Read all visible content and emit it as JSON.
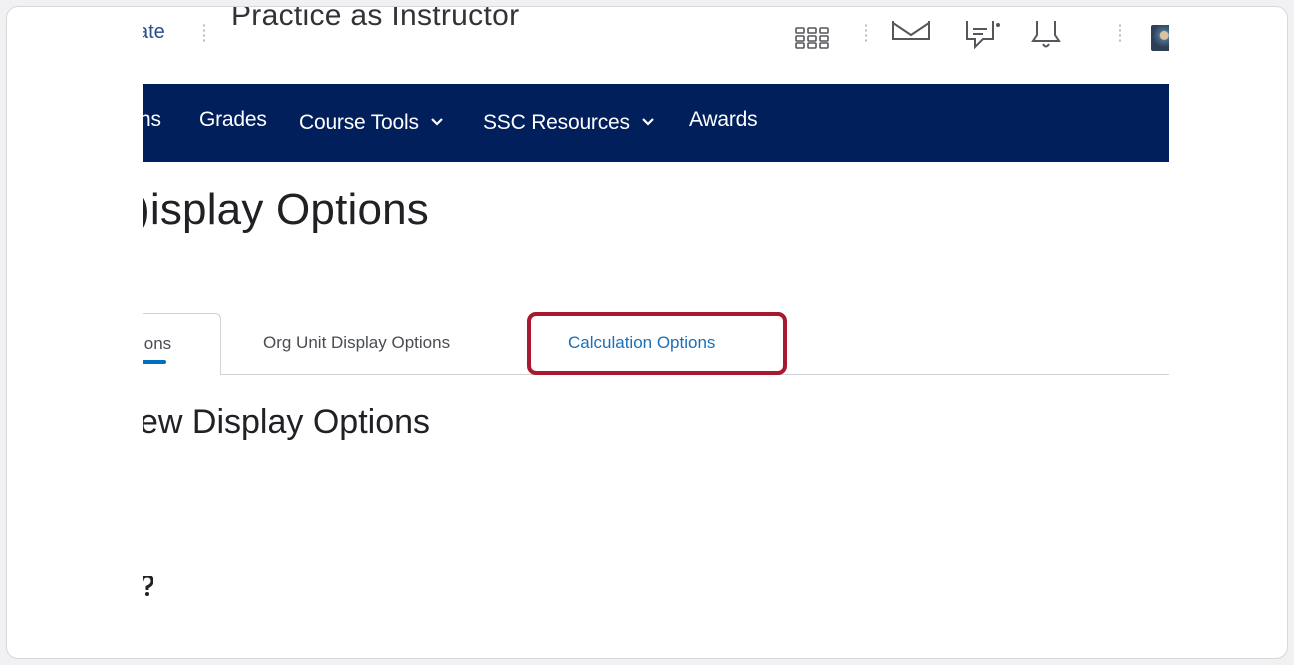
{
  "header": {
    "brand_fragment": "ate",
    "course_title": "Practice as Instructor",
    "icons": [
      "apps-grid-icon",
      "mail-icon",
      "chat-icon",
      "bell-icon",
      "avatar"
    ]
  },
  "navbar": {
    "items": [
      {
        "label": "ns"
      },
      {
        "label": "Grades"
      },
      {
        "label": "Course Tools",
        "dropdown": true
      },
      {
        "label": "SSC Resources",
        "dropdown": true
      },
      {
        "label": "Awards"
      }
    ],
    "color": "#001f5b"
  },
  "page": {
    "title": "Display Options",
    "title_visible": ")isplay Options",
    "tabs": [
      {
        "label": "ions",
        "active": true
      },
      {
        "label": "Org Unit Display Options",
        "active": false
      },
      {
        "label": "Calculation Options",
        "active": false,
        "highlighted": true
      }
    ],
    "section_title": "ew Display Options",
    "help_glyph": "?"
  },
  "colors": {
    "accent": "#006fbf",
    "highlight": "#a71930",
    "link": "#1c6fb8"
  }
}
